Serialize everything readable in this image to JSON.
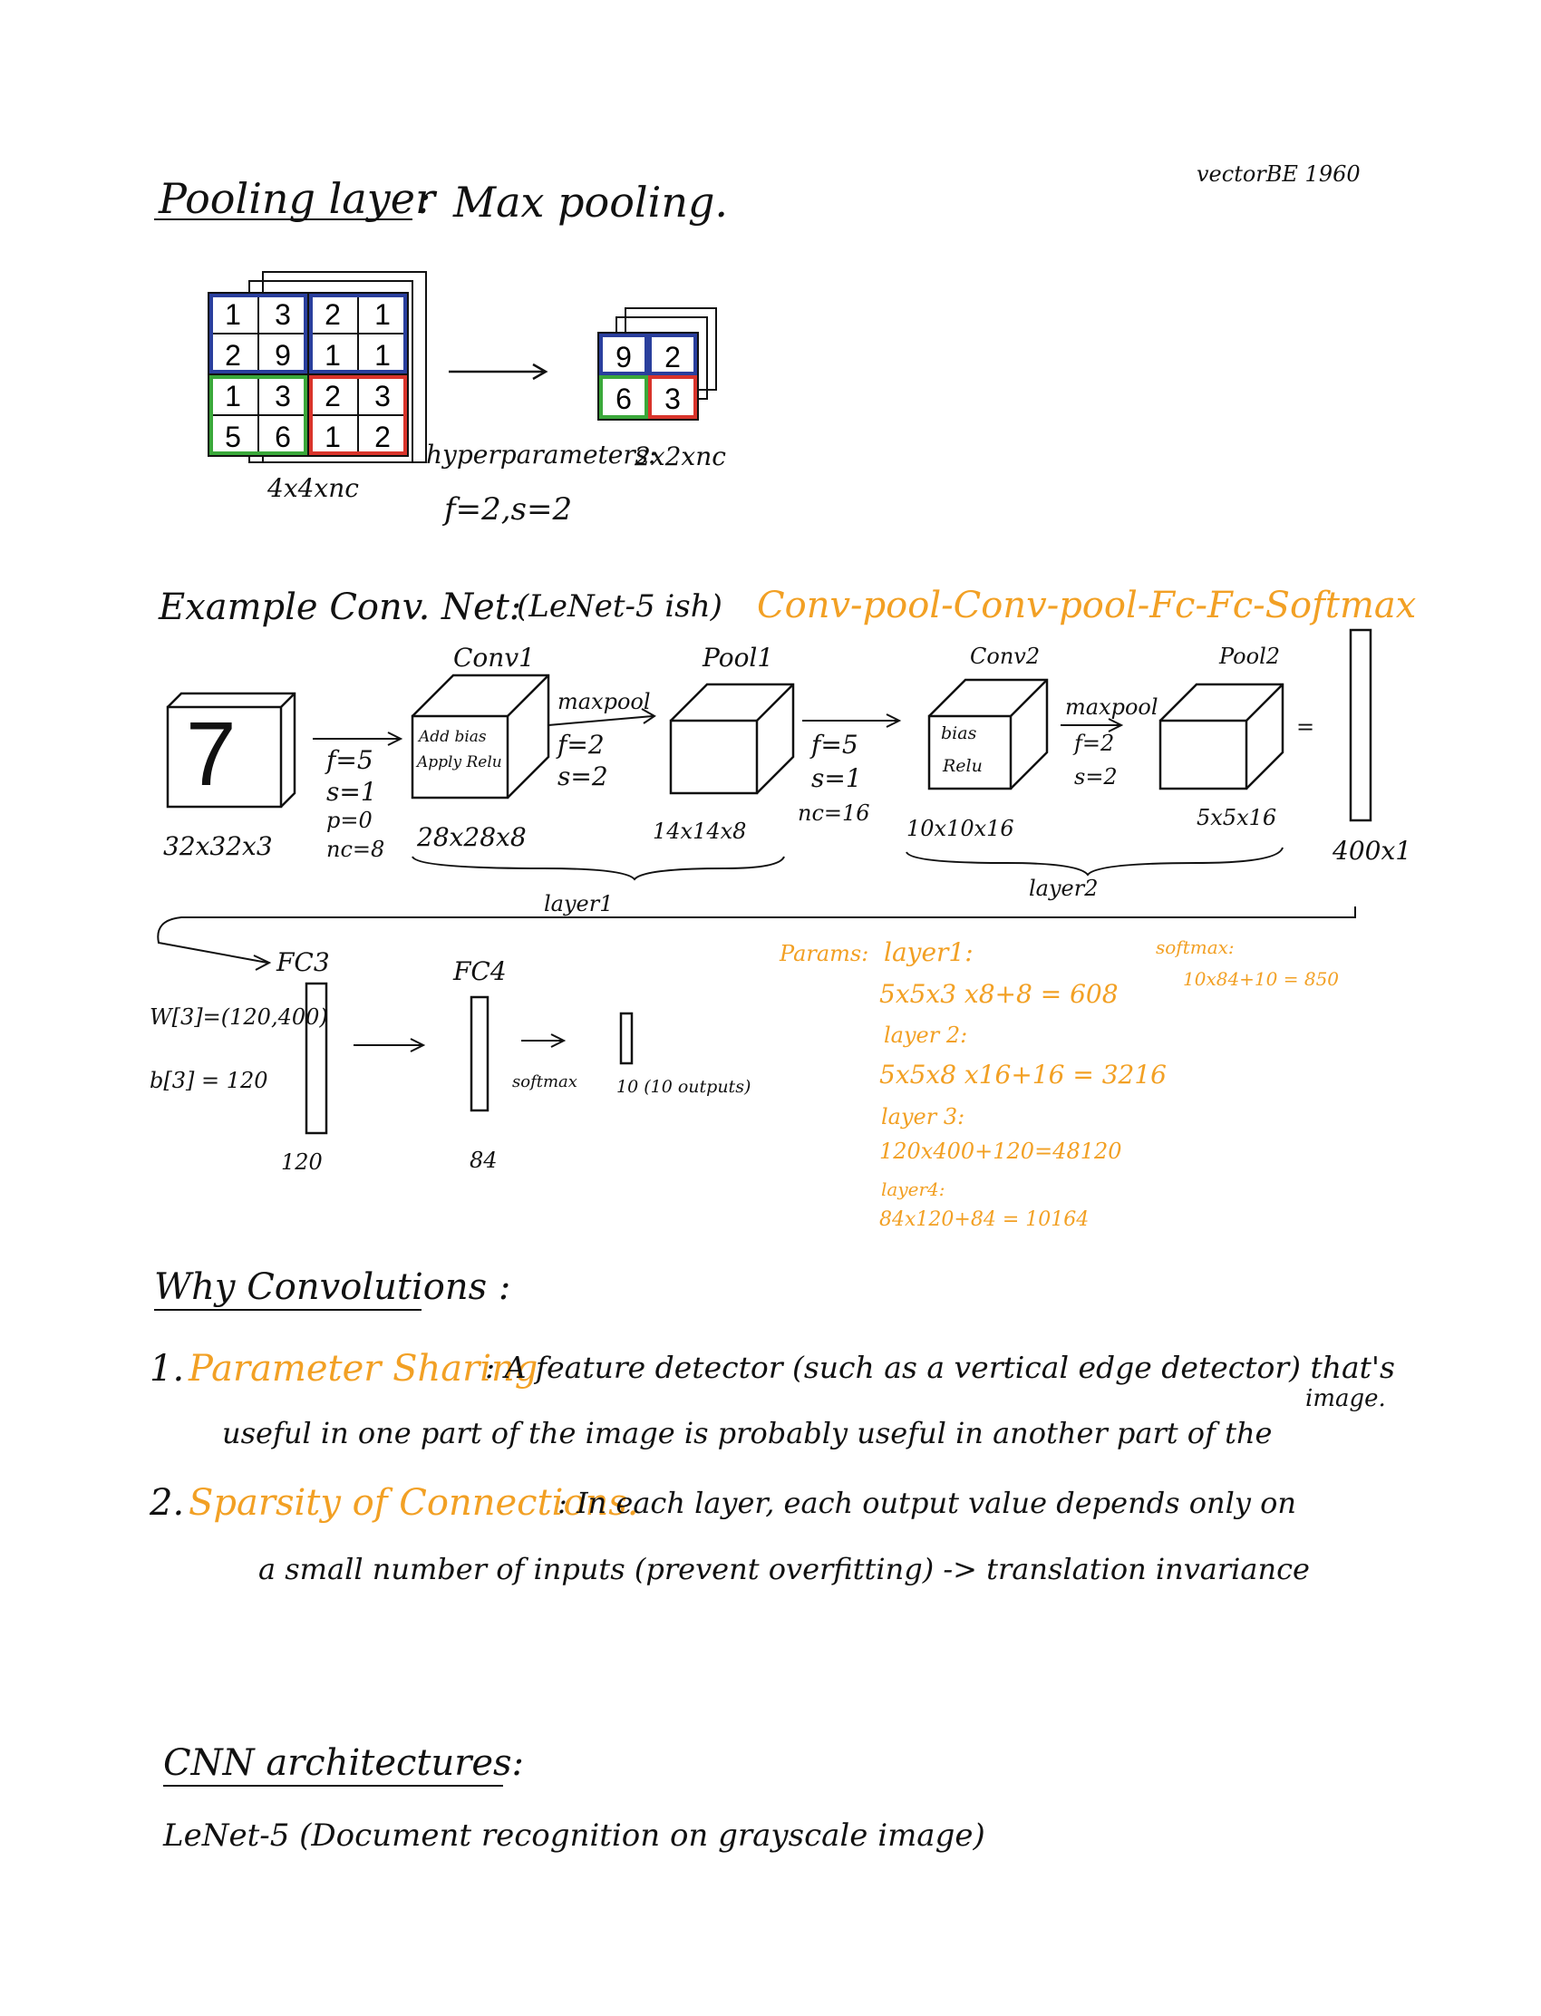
{
  "signature": "vectorBE 1960",
  "pooling": {
    "title": "Pooling layer",
    "colon": ":",
    "subtitle": "Max pooling.",
    "input_grid": [
      [
        "1",
        "3",
        "2",
        "1"
      ],
      [
        "2",
        "9",
        "1",
        "1"
      ],
      [
        "1",
        "3",
        "2",
        "3"
      ],
      [
        "5",
        "6",
        "1",
        "2"
      ]
    ],
    "output_grid": [
      [
        "9",
        "2"
      ],
      [
        "6",
        "3"
      ]
    ],
    "input_dims": "4x4xnc",
    "hyper_label": "hyperparameters:",
    "hyper_values": "f=2,s=2",
    "output_dims": "2x2xnc",
    "colors": {
      "blue": "#2a3f9d",
      "green": "#3aa83a",
      "red": "#d9342b"
    }
  },
  "example": {
    "title": "Example Conv. Net:",
    "paren": "(LeNet-5 ish)",
    "sequence": "Conv-pool-Conv-pool-Fc-Fc-Softmax",
    "input_digit": "7",
    "input_dims": "32x32x3",
    "conv1_params": [
      "f=5",
      "s=1",
      "p=0",
      "nc=8"
    ],
    "conv1_label": "Conv1",
    "conv1_inner": [
      "Add bias",
      "Apply Relu"
    ],
    "conv1_dims": "28x28x8",
    "maxpool1": [
      "maxpool",
      "f=2",
      "s=2"
    ],
    "pool1_label": "Pool1",
    "pool1_dims": "14x14x8",
    "conv2_params": [
      "f=5",
      "s=1",
      "nc=16"
    ],
    "conv2_label": "Conv2",
    "conv2_inner": [
      "bias",
      "Relu"
    ],
    "conv2_dims": "10x10x16",
    "maxpool2": [
      "maxpool",
      "f=2",
      "s=2"
    ],
    "pool2_label": "Pool2",
    "pool2_dims": "5x5x16",
    "equals": "=",
    "flat_dims": "400x1",
    "layer1": "layer1",
    "layer2": "layer2",
    "fc3_label": "FC3",
    "w3": "W[3]=(120,400)",
    "b3": "b[3] = 120",
    "fc3_size": "120",
    "fc4_label": "FC4",
    "fc4_size": "84",
    "softmax_label": "softmax",
    "output": "10 (10 outputs)"
  },
  "params": {
    "title": "Params:",
    "layer1_label": "layer1:",
    "layer1_calc": "5x5x3 x8+8 = 608",
    "layer2_label": "layer 2:",
    "layer2_calc": "5x5x8 x16+16 = 3216",
    "layer3_label": "layer 3:",
    "layer3_calc": "120x400+120=48120",
    "layer4_label": "layer4:",
    "layer4_calc": "84x120+84 = 10164",
    "softmax_label": "softmax:",
    "softmax_calc": "10x84+10 = 850"
  },
  "why": {
    "title": "Why Convolutions :",
    "item1_num": "1.",
    "item1_head": "Parameter Sharing",
    "item1_text1": ": A feature detector (such as a vertical edge detector) that's",
    "item1_text2": "useful in one part of the image is probably useful in another part of the",
    "item1_text3": "image.",
    "item2_num": "2.",
    "item2_head": "Sparsity of Connections.",
    "item2_text1": ": In each layer, each output value depends only on",
    "item2_text2": "a small number of inputs (prevent overfitting) -> translation invariance"
  },
  "cnn": {
    "title": "CNN architectures:",
    "lenet": "LeNet-5 (Document recognition on grayscale image)"
  }
}
